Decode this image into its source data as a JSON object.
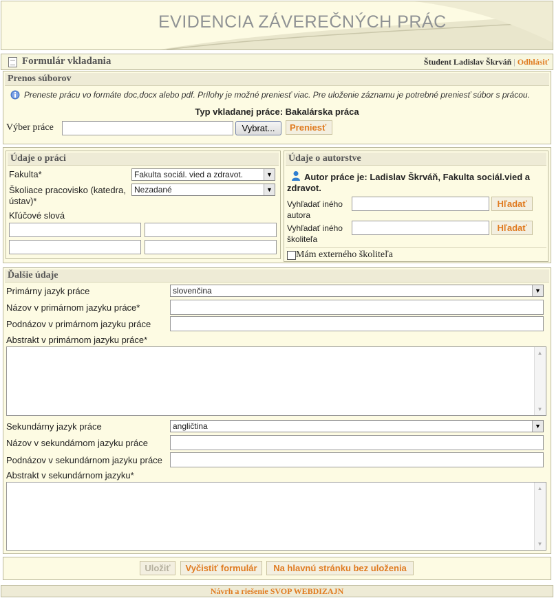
{
  "header": {
    "title": "EVIDENCIA ZÁVEREČNÝCH PRÁC"
  },
  "titlebar": {
    "form_title": "Formulár vkladania",
    "user": "Študent Ladislav Škrváň",
    "separator": "|",
    "logout": "Odhlásiť"
  },
  "upload": {
    "heading": "Prenos súborov",
    "info": "Preneste prácu vo formáte doc,docx alebo pdf. Prílohy je možné preniesť viac. Pre uloženie záznamu je potrebné preniesť súbor s prácou.",
    "type_line": "Typ vkladanej práce: Bakalárska práca",
    "file_label": "Výber práce",
    "file_value": "",
    "browse_button": "Vybrat...",
    "transfer_button": "Preniesť"
  },
  "work": {
    "heading": "Údaje o práci",
    "faculty_label": "Fakulta*",
    "faculty_value": "Fakulta sociál. vied a zdravot.",
    "department_label": "Školiace pracovisko (katedra, ústav)*",
    "department_value": "Nezadané",
    "keywords_label": "Kľúčové slová",
    "keywords": [
      "",
      "",
      "",
      ""
    ]
  },
  "authorship": {
    "heading": "Údaje o autorstve",
    "author_line": "Autor práce je: Ladislav Škrváň, Fakulta sociál.vied a zdravot.",
    "search_author_label": "Vyhľadať iného autora",
    "search_supervisor_label": "Vyhľadať iného školiteľa",
    "search_button": "Hľadať",
    "external_supervisor_label": "Mám externého školiteľa",
    "external_supervisor_checked": false
  },
  "more": {
    "heading": "Ďalšie údaje",
    "primary_language_label": "Primárny jazyk práce",
    "primary_language_value": "slovenčina",
    "primary_title_label": "Názov v primárnom jazyku práce*",
    "primary_subtitle_label": "Podnázov v primárnom jazyku práce",
    "primary_abstract_label": "Abstrakt v primárnom jazyku práce*",
    "secondary_language_label": "Sekundárny jazyk práce",
    "secondary_language_value": "angličtina",
    "secondary_title_label": "Názov v sekundárnom jazyku práce",
    "secondary_subtitle_label": "Podnázov v sekundárnom jazyku práce",
    "secondary_abstract_label": "Abstrakt v sekundárnom jazyku*"
  },
  "actions": {
    "save": "Uložiť",
    "clear": "Vyčistiť formulár",
    "home": "Na hlavnú stránku bez uloženia"
  },
  "footer": {
    "text": "Návrh a riešenie SVOP WEBDIZAJN"
  },
  "colors": {
    "accent": "#e07b20",
    "panel_bg": "#fdfbe3",
    "border": "#b9b79a"
  }
}
